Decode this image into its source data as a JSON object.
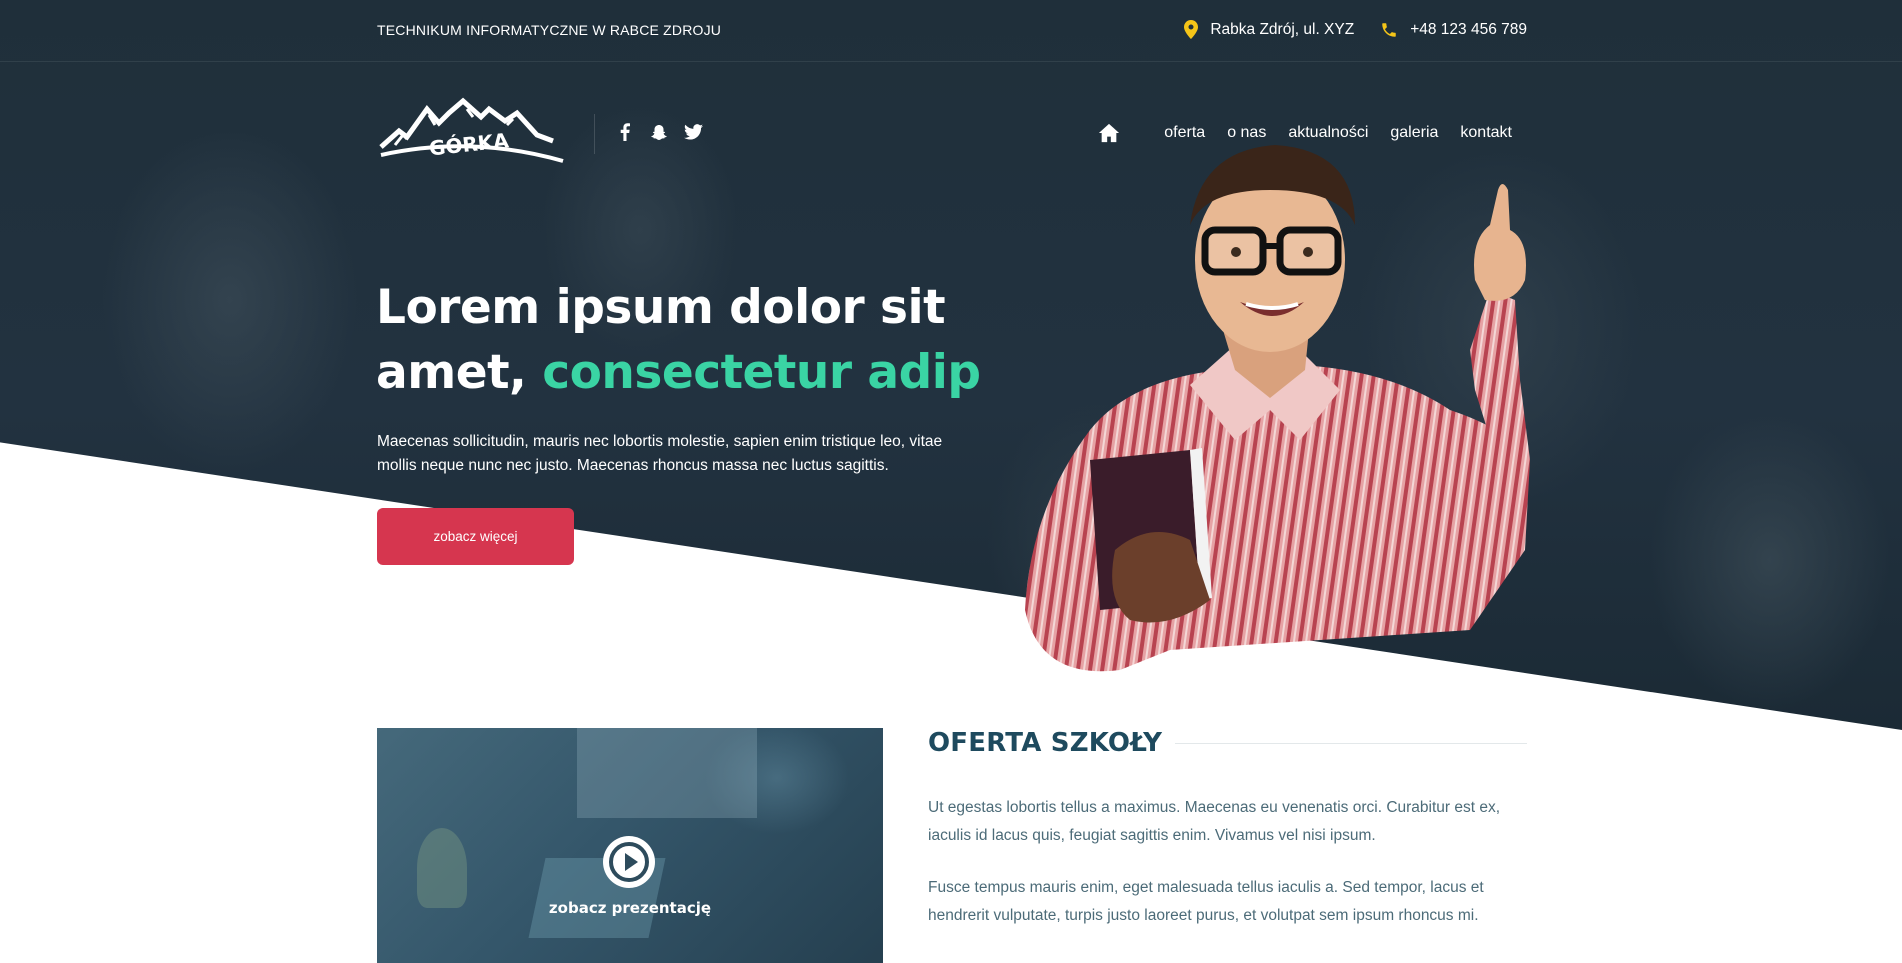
{
  "topbar": {
    "school_name": "TECHNIKUM INFORMATYCZNE W RABCE ZDROJU",
    "address": "Rabka Zdrój, ul. XYZ",
    "phone": "+48 123 456 789",
    "icon_color": "#f5c518"
  },
  "logo": {
    "text": "GÓRKA"
  },
  "social": [
    "facebook-icon",
    "snapchat-icon",
    "twitter-icon"
  ],
  "nav": {
    "home_icon": "home-icon",
    "items": [
      "oferta",
      "o nas",
      "aktualności",
      "galeria",
      "kontakt"
    ]
  },
  "hero": {
    "title_line1": "Lorem ipsum dolor sit",
    "title_line2_prefix": "amet,",
    "title_line2_accent": "consectetur adip",
    "description": "Maecenas sollicitudin, mauris nec lobortis molestie, sapien enim tristique leo, vitae mollis neque nunc nec justo. Maecenas rhoncus massa nec luctus sagittis.",
    "cta_label": "zobacz więcej",
    "accent_color": "#3ad4a4",
    "cta_color": "#d6364f"
  },
  "video": {
    "label": "zobacz prezentację",
    "icon": "play-icon"
  },
  "offer": {
    "title": "OFERTA SZKOŁY",
    "paragraph1": "Ut egestas lobortis tellus a maximus. Maecenas eu venenatis orci. Curabitur est ex, iaculis id lacus quis, feugiat sagittis enim. Vivamus vel nisi ipsum.",
    "paragraph2": "Fusce tempus mauris enim, eget malesuada tellus iaculis a. Sed tempor, lacus et hendrerit vulputate, turpis justo laoreet purus, et volutpat sem ipsum rhoncus mi.",
    "title_color": "#1e4a5e"
  }
}
